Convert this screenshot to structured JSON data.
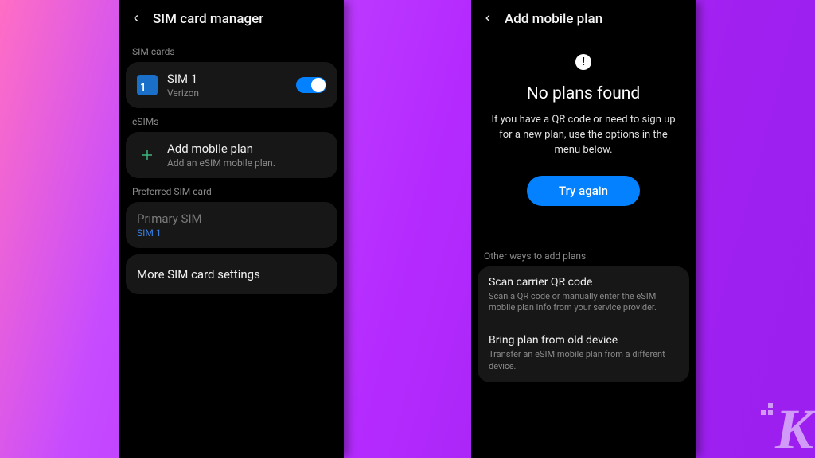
{
  "left": {
    "header_title": "SIM card manager",
    "sections": {
      "sim_cards_label": "SIM cards",
      "esims_label": "eSIMs",
      "preferred_label": "Preferred SIM card"
    },
    "sim1": {
      "badge": "1",
      "name": "SIM 1",
      "carrier": "Verizon",
      "enabled": true
    },
    "add_plan": {
      "title": "Add mobile plan",
      "subtitle": "Add an eSIM mobile plan."
    },
    "primary": {
      "title": "Primary SIM",
      "value": "SIM 1"
    },
    "more_settings": "More SIM card settings"
  },
  "right": {
    "header_title": "Add mobile plan",
    "empty": {
      "title": "No plans found",
      "desc": "If you have a QR code or need to sign up for a new plan, use the options in the menu below.",
      "button": "Try again"
    },
    "other_label": "Other ways to add plans",
    "options": [
      {
        "title": "Scan carrier QR code",
        "desc": "Scan a QR code or manually enter the eSIM mobile plan info from your service provider."
      },
      {
        "title": "Bring plan from old device",
        "desc": "Transfer an eSIM mobile plan from a different device."
      }
    ]
  },
  "colors": {
    "accent": "#0381fe",
    "sim_badge": "#1a6fc9",
    "add_icon": "#3fb67f"
  }
}
